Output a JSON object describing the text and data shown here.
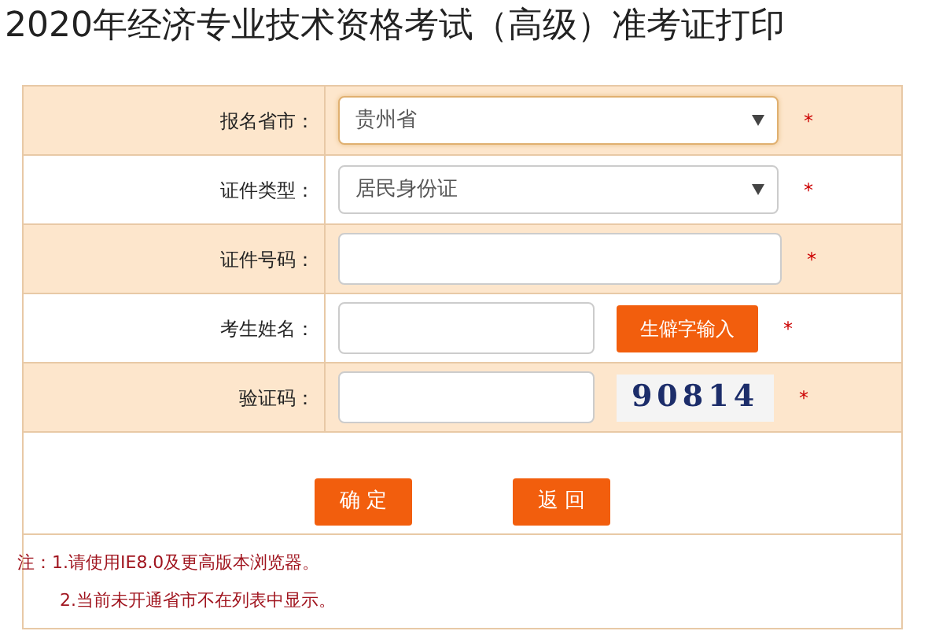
{
  "title": "2020年经济专业技术资格考试（高级）准考证打印",
  "fields": [
    {
      "label": "报名省市：",
      "kind": "select",
      "value": "贵州省",
      "focused": true,
      "required": "*"
    },
    {
      "label": "证件类型：",
      "kind": "select",
      "value": "居民身份证",
      "focused": false,
      "required": "*"
    },
    {
      "label": "证件号码：",
      "kind": "input",
      "required": "*"
    },
    {
      "label": "考生姓名：",
      "kind": "input_button",
      "button": "生僻字输入",
      "required": "*"
    },
    {
      "label": "验证码：",
      "kind": "input_captcha",
      "captcha": "90814",
      "required": "*"
    }
  ],
  "buttons": [
    "确 定",
    "返 回"
  ],
  "notes": [
    "注：1.请使用IE8.0及更高版本浏览器。",
    "2.当前未开通省市不在列表中显示。"
  ]
}
